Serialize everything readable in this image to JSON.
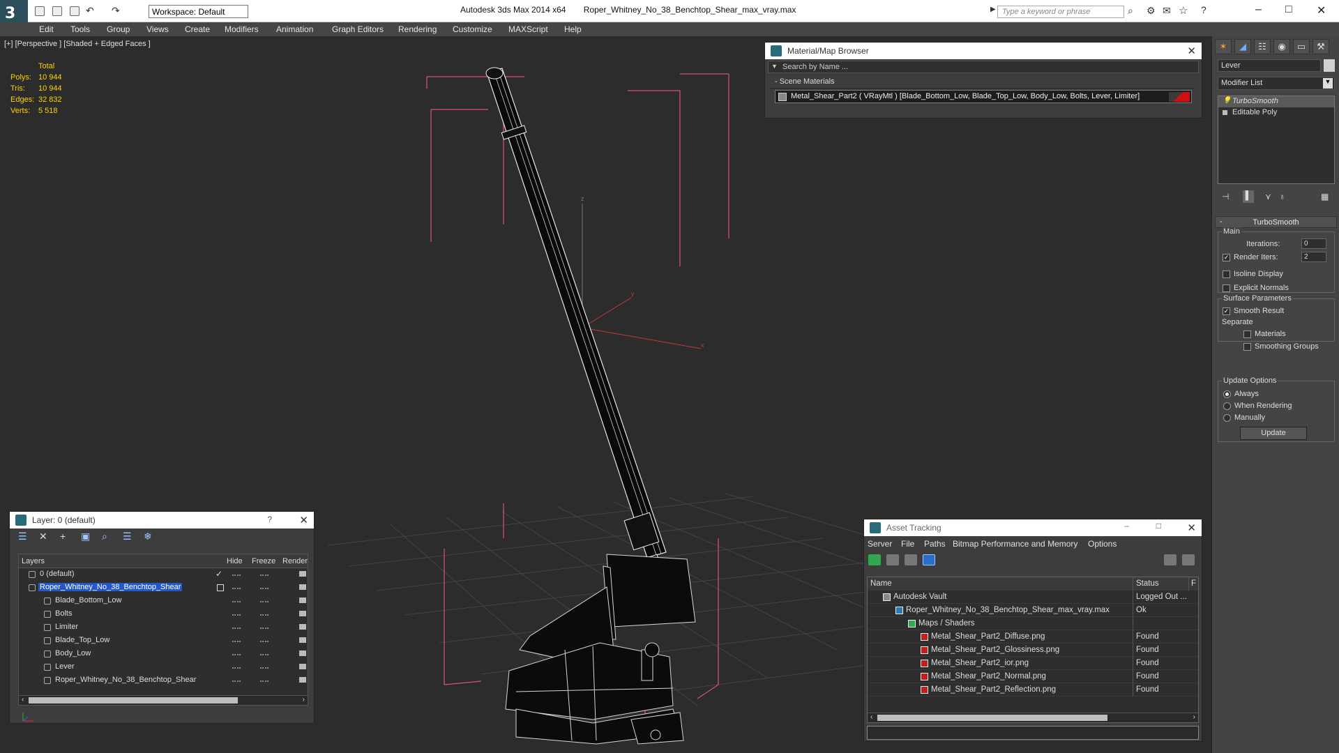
{
  "app": {
    "window_title_app": "Autodesk 3ds Max  2014 x64",
    "window_title_file": "Roper_Whitney_No_38_Benchtop_Shear_max_vray.max",
    "workspace": "Workspace: Default",
    "search_placeholder": "Type a keyword or phrase"
  },
  "menu": [
    "Edit",
    "Tools",
    "Group",
    "Views",
    "Create",
    "Modifiers",
    "Animation",
    "Graph Editors",
    "Rendering",
    "Customize",
    "MAXScript",
    "Help"
  ],
  "viewport": {
    "label": "[+] [Perspective ] [Shaded + Edged Faces ]",
    "stats": {
      "header": "Total",
      "rows": [
        {
          "k": "Polys:",
          "v": "10 944"
        },
        {
          "k": "Tris:",
          "v": "10 944"
        },
        {
          "k": "Edges:",
          "v": "32 832"
        },
        {
          "k": "Verts:",
          "v": "5 518"
        }
      ]
    },
    "axis_labels": {
      "x": "x",
      "y": "y",
      "z": "z"
    }
  },
  "material_browser": {
    "title": "Material/Map Browser",
    "search_placeholder": "Search by Name ...",
    "section": "- Scene Materials",
    "material": "Metal_Shear_Part2  ( VRayMtl ) [Blade_Bottom_Low, Blade_Top_Low, Body_Low, Bolts, Lever, Limiter]",
    "swatch_color": "#d01010"
  },
  "command_panel": {
    "object_name": "Lever",
    "modifier_list": "Modifier List",
    "stack": [
      "TurboSmooth",
      "Editable Poly"
    ],
    "rollout": "TurboSmooth",
    "main_group": "Main",
    "iterations_label": "Iterations:",
    "iterations_value": "0",
    "render_iters_label": "Render Iters:",
    "render_iters_value": "2",
    "isoline_display": "Isoline Display",
    "explicit_normals": "Explicit Normals",
    "surface_params": "Surface Parameters",
    "smooth_result": "Smooth Result",
    "separate": "Separate",
    "materials": "Materials",
    "smoothing_groups": "Smoothing Groups",
    "update_options": "Update Options",
    "always": "Always",
    "when_rendering": "When Rendering",
    "manually": "Manually",
    "update_button": "Update"
  },
  "layer_dialog": {
    "title": "Layer: 0 (default)",
    "help": "?",
    "columns": {
      "layers": "Layers",
      "hide": "Hide",
      "freeze": "Freeze",
      "render": "Render"
    },
    "rows": [
      {
        "name": "0 (default)",
        "indent": 0
      },
      {
        "name": "Roper_Whitney_No_38_Benchtop_Shear",
        "indent": 0
      },
      {
        "name": "Blade_Bottom_Low",
        "indent": 1
      },
      {
        "name": "Bolts",
        "indent": 1
      },
      {
        "name": "Limiter",
        "indent": 1
      },
      {
        "name": "Blade_Top_Low",
        "indent": 1
      },
      {
        "name": "Body_Low",
        "indent": 1
      },
      {
        "name": "Lever",
        "indent": 1
      },
      {
        "name": "Roper_Whitney_No_38_Benchtop_Shear",
        "indent": 1
      }
    ]
  },
  "asset_tracking": {
    "title": "Asset Tracking",
    "menu": [
      "Server",
      "File",
      "Paths",
      "Bitmap Performance and Memory",
      "Options"
    ],
    "col_name": "Name",
    "col_status": "Status",
    "col_extra": "F",
    "rows": [
      {
        "name": "Autodesk Vault",
        "status": "Logged Out ...",
        "indent": 1,
        "icon": "vault"
      },
      {
        "name": "Roper_Whitney_No_38_Benchtop_Shear_max_vray.max",
        "status": "Ok",
        "indent": 2,
        "icon": "max"
      },
      {
        "name": "Maps / Shaders",
        "status": "",
        "indent": 3,
        "icon": "folder"
      },
      {
        "name": "Metal_Shear_Part2_Diffuse.png",
        "status": "Found",
        "indent": 4,
        "icon": "png"
      },
      {
        "name": "Metal_Shear_Part2_Glossiness.png",
        "status": "Found",
        "indent": 4,
        "icon": "png"
      },
      {
        "name": "Metal_Shear_Part2_ior.png",
        "status": "Found",
        "indent": 4,
        "icon": "png"
      },
      {
        "name": "Metal_Shear_Part2_Normal.png",
        "status": "Found",
        "indent": 4,
        "icon": "png"
      },
      {
        "name": "Metal_Shear_Part2_Reflection.png",
        "status": "Found",
        "indent": 4,
        "icon": "png"
      }
    ]
  }
}
